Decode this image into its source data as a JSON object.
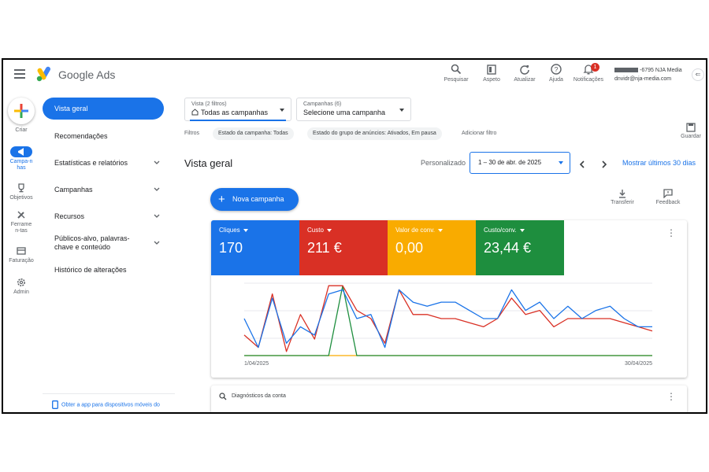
{
  "app": {
    "brand": "Google Ads"
  },
  "topbar": {
    "actions": [
      {
        "label": "Pesquisar",
        "icon": "search-icon"
      },
      {
        "label": "Aspeto",
        "icon": "appearance-icon"
      },
      {
        "label": "Atualizar",
        "icon": "refresh-icon"
      },
      {
        "label": "Ajuda",
        "icon": "help-icon"
      },
      {
        "label": "Notificações",
        "icon": "bell-icon",
        "badge": "1"
      }
    ],
    "account": {
      "line1": "-6795 NJA Media",
      "line2": "dnvidr@nja-media.com",
      "avatar": "⇐"
    }
  },
  "rail": {
    "create_label": "Criar",
    "items": [
      {
        "label": "Campa-nhas",
        "icon": "megaphone-icon",
        "active": true
      },
      {
        "label": "Objetivos",
        "icon": "trophy-icon"
      },
      {
        "label": "Ferramen-tas",
        "icon": "tools-icon"
      },
      {
        "label": "Faturação",
        "icon": "billing-icon"
      },
      {
        "label": "Admin",
        "icon": "gear-icon"
      }
    ]
  },
  "nav": {
    "items": [
      {
        "label": "Vista geral",
        "active": true
      },
      {
        "label": "Recomendações"
      },
      {
        "label": "Estatísticas e relatórios",
        "expand": true
      },
      {
        "label": "Campanhas",
        "expand": true
      },
      {
        "label": "Recursos",
        "expand": true
      },
      {
        "label": "Públicos-alvo, palavras-chave e conteúdo",
        "expand": true
      },
      {
        "label": "Histórico de alterações"
      }
    ],
    "bottom_link": "Obter a app para dispositivos móveis do"
  },
  "selectors": {
    "view": {
      "small": "Vista (2 filtros)",
      "value": "Todas as campanhas"
    },
    "campaigns": {
      "small": "Campanhas (6)",
      "value": "Selecione uma campanha"
    }
  },
  "filters": {
    "label": "Filtros",
    "chips": [
      "Estado da campanha: Todas",
      "Estado do grupo de anúncios: Ativados, Em pausa"
    ],
    "add_filter": "Adicionar filtro",
    "save_label": "Guardar"
  },
  "main": {
    "title": "Vista geral",
    "date_label": "Personalizado",
    "date_range": "1 – 30 de abr. de 2025",
    "show_last": "Mostrar últimos 30 dias",
    "new_campaign": "Nova campanha",
    "tools": [
      {
        "label": "Transferir",
        "icon": "download-icon"
      },
      {
        "label": "Feedback",
        "icon": "feedback-icon"
      }
    ]
  },
  "metrics": [
    {
      "label": "Cliques",
      "value": "170",
      "color": "#1a73e8"
    },
    {
      "label": "Custo",
      "value": "211 €",
      "color": "#d93025"
    },
    {
      "label": "Valor de conv.",
      "value": "0,00",
      "color": "#f9ab00"
    },
    {
      "label": "Custo/conv.",
      "value": "23,44 €",
      "color": "#1e8e3e"
    }
  ],
  "chart_data": {
    "type": "line",
    "x_start_label": "1/04/2025",
    "x_end_label": "30/04/2025",
    "x": [
      1,
      2,
      3,
      4,
      5,
      6,
      7,
      8,
      9,
      10,
      11,
      12,
      13,
      14,
      15,
      16,
      17,
      18,
      19,
      20,
      21,
      22,
      23,
      24,
      25,
      26,
      27,
      28,
      29,
      30
    ],
    "series": [
      {
        "name": "Cliques",
        "color": "#1a73e8",
        "values": [
          9,
          2,
          14,
          3,
          7,
          5,
          15,
          16,
          9,
          10,
          2,
          16,
          13,
          12,
          13,
          13,
          11,
          9,
          9,
          16,
          11,
          13,
          9,
          12,
          9,
          11,
          12,
          9,
          7,
          7
        ]
      },
      {
        "name": "Custo",
        "color": "#d93025",
        "values": [
          5,
          2,
          15,
          1,
          10,
          4,
          17,
          17,
          11,
          9,
          3,
          16,
          10,
          10,
          9,
          9,
          8,
          7,
          9,
          14,
          10,
          11,
          7,
          9,
          9,
          9,
          9,
          8,
          7,
          6
        ]
      },
      {
        "name": "Valor de conv.",
        "color": "#f9ab00",
        "values": [
          0,
          0,
          0,
          0,
          0,
          0,
          0,
          0,
          0,
          0,
          0,
          0,
          0,
          0,
          0,
          0,
          0,
          0,
          0,
          0,
          0,
          0,
          0,
          0,
          0,
          0,
          0,
          0,
          0,
          0
        ]
      },
      {
        "name": "Custo/conv.",
        "color": "#1e8e3e",
        "values": [
          0,
          0,
          0,
          0,
          0,
          0,
          0,
          17,
          0,
          0,
          0,
          0,
          0,
          0,
          0,
          0,
          0,
          0,
          0,
          0,
          0,
          0,
          0,
          0,
          0,
          0,
          0,
          0,
          0,
          0
        ]
      }
    ]
  },
  "diagnostics": {
    "title": "Diagnósticos da conta"
  }
}
